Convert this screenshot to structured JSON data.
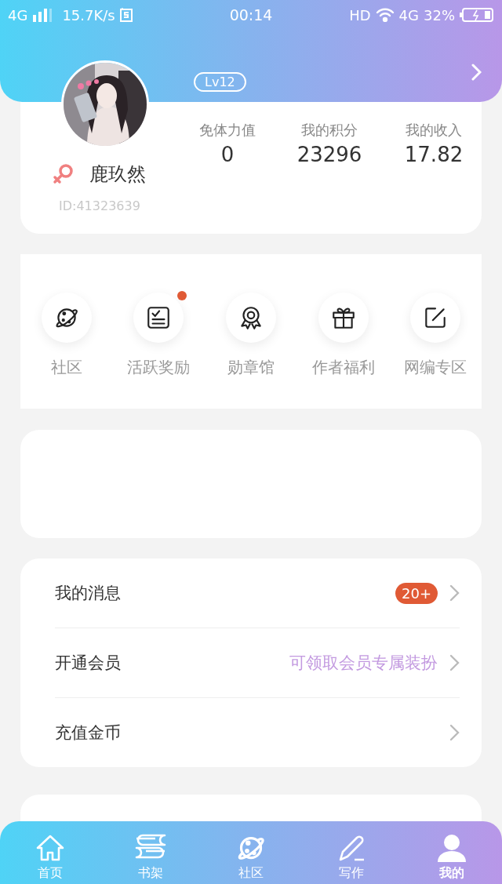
{
  "status_bar": {
    "network": "4G",
    "speed": "15.7K/s",
    "time": "00:14",
    "hd": "HD",
    "network_right": "4G",
    "battery": "32%"
  },
  "profile": {
    "level": "Lv12",
    "name": "鹿玖然",
    "id": "ID:41323639",
    "stats": [
      {
        "label": "免体力值",
        "value": "0"
      },
      {
        "label": "我的积分",
        "value": "23296"
      },
      {
        "label": "我的收入",
        "value": "17.82"
      }
    ]
  },
  "shortcuts": [
    {
      "label": "社区",
      "kind": "planet",
      "badge": false
    },
    {
      "label": "活跃奖励",
      "kind": "checklist",
      "badge": true
    },
    {
      "label": "勋章馆",
      "kind": "medal",
      "badge": false
    },
    {
      "label": "作者福利",
      "kind": "gift",
      "badge": false
    },
    {
      "label": "网编专区",
      "kind": "edit",
      "badge": false
    }
  ],
  "menu": [
    {
      "label": "我的消息",
      "badge": "20+"
    },
    {
      "label": "开通会员",
      "hint": "可领取会员专属装扮"
    },
    {
      "label": "充值金币"
    }
  ],
  "tabs": [
    {
      "label": "首页",
      "kind": "home",
      "selected": false
    },
    {
      "label": "书架",
      "kind": "books",
      "selected": false
    },
    {
      "label": "社区",
      "kind": "planet",
      "selected": false
    },
    {
      "label": "写作",
      "kind": "pen",
      "selected": false
    },
    {
      "label": "我的",
      "kind": "user",
      "selected": true
    }
  ]
}
